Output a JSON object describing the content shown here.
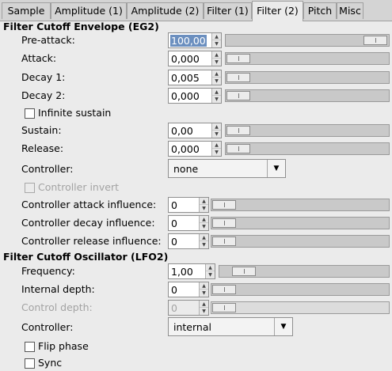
{
  "tabs": [
    {
      "label": "Sample"
    },
    {
      "label": "Amplitude (1)"
    },
    {
      "label": "Amplitude (2)"
    },
    {
      "label": "Filter (1)"
    },
    {
      "label": "Filter (2)"
    },
    {
      "label": "Pitch"
    },
    {
      "label": "Misc"
    }
  ],
  "active_tab": "Filter (2)",
  "eg2": {
    "title": "Filter Cutoff Envelope (EG2)",
    "pre_attack": {
      "label": "Pre-attack:",
      "value": "100,00",
      "level": 0.97
    },
    "attack": {
      "label": "Attack:",
      "value": "0,000",
      "level": 0.0
    },
    "decay1": {
      "label": "Decay 1:",
      "value": "0,005",
      "level": 0.0
    },
    "decay2": {
      "label": "Decay 2:",
      "value": "0,000",
      "level": 0.0
    },
    "infinite_sustain": {
      "label": "Infinite sustain",
      "checked": false
    },
    "sustain": {
      "label": "Sustain:",
      "value": "0,00",
      "level": 0.0
    },
    "release": {
      "label": "Release:",
      "value": "0,000",
      "level": 0.0
    },
    "controller": {
      "label": "Controller:",
      "value": "none"
    },
    "controller_invert": {
      "label": "Controller invert",
      "checked": false
    },
    "attack_influence": {
      "label": "Controller attack influence:",
      "value": "0",
      "level": 0.0
    },
    "decay_influence": {
      "label": "Controller decay influence:",
      "value": "0",
      "level": 0.0
    },
    "release_influence": {
      "label": "Controller release influence:",
      "value": "0",
      "level": 0.0
    }
  },
  "lfo2": {
    "title": "Filter Cutoff Oscillator (LFO2)",
    "frequency": {
      "label": "Frequency:",
      "value": "1,00",
      "level": 0.05
    },
    "internal_depth": {
      "label": "Internal depth:",
      "value": "0",
      "level": 0.0
    },
    "control_depth": {
      "label": "Control depth:",
      "value": "0",
      "level": 0.0
    },
    "controller": {
      "label": "Controller:",
      "value": "internal"
    },
    "flip_phase": {
      "label": "Flip phase",
      "checked": false
    },
    "sync": {
      "label": "Sync",
      "checked": false
    }
  },
  "icons": {
    "spin_up": "arrow-up-icon",
    "spin_down": "arrow-down-icon",
    "dropdown": "triangle-down-icon"
  }
}
